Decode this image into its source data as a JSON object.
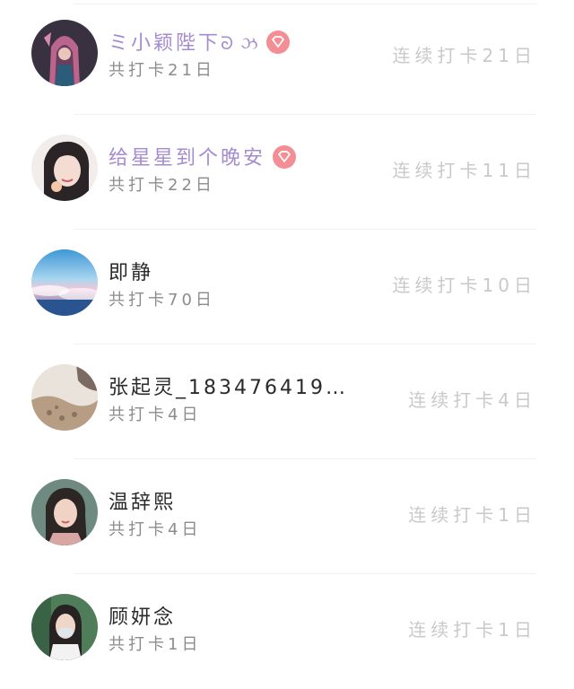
{
  "users": [
    {
      "name": "ミ小颖陛下",
      "name_ornament": "ᘐ ઝ",
      "vip": true,
      "total": "共打卡21日",
      "streak": "连续打卡21日"
    },
    {
      "name": "给星星到个晚安",
      "vip": true,
      "total": "共打卡22日",
      "streak": "连续打卡11日"
    },
    {
      "name": "即静",
      "vip": false,
      "total": "共打卡70日",
      "streak": "连续打卡10日"
    },
    {
      "name": "张起灵_183476419…",
      "vip": false,
      "total": "共打卡4日",
      "streak": "连续打卡4日"
    },
    {
      "name": "温辞熙",
      "vip": false,
      "total": "共打卡4日",
      "streak": "连续打卡1日"
    },
    {
      "name": "顾妍念",
      "vip": false,
      "total": "共打卡1日",
      "streak": "连续打卡1日"
    }
  ],
  "colors": {
    "vip_name": "#a58bd1",
    "vip_badge": "#f28e94",
    "name": "#2a2a2a",
    "total": "#8c8c8c",
    "streak": "#c9c9c9"
  },
  "icons": {
    "vip_badge": "diamond-icon"
  }
}
